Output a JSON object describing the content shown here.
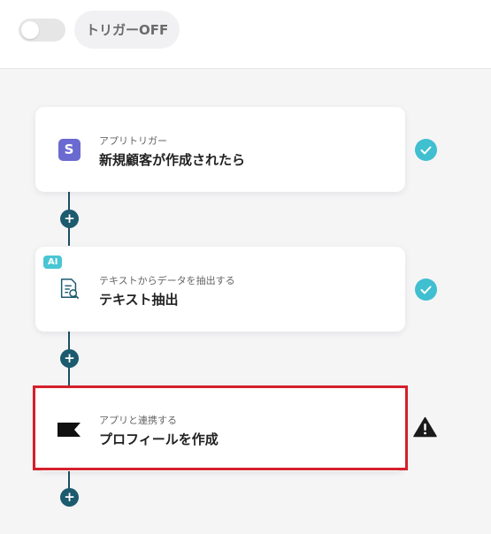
{
  "header": {
    "toggle_state": "off",
    "trigger_label": "トリガーOFF"
  },
  "steps": [
    {
      "subtitle": "アプリトリガー",
      "title": "新規顧客が作成されたら",
      "icon": "stripe-s-icon",
      "status": "complete"
    },
    {
      "badge": "AI",
      "subtitle": "テキストからデータを抽出する",
      "title": "テキスト抽出",
      "icon": "document-search-icon",
      "status": "complete"
    },
    {
      "subtitle": "アプリと連携する",
      "title": "プロフィールを作成",
      "icon": "black-flag-icon",
      "status": "warning",
      "highlighted": true
    }
  ],
  "colors": {
    "accent_teal": "#3fbfd0",
    "connector": "#1c4f63",
    "highlight": "#d5202b",
    "stripe_purple": "#6a6ad0"
  }
}
